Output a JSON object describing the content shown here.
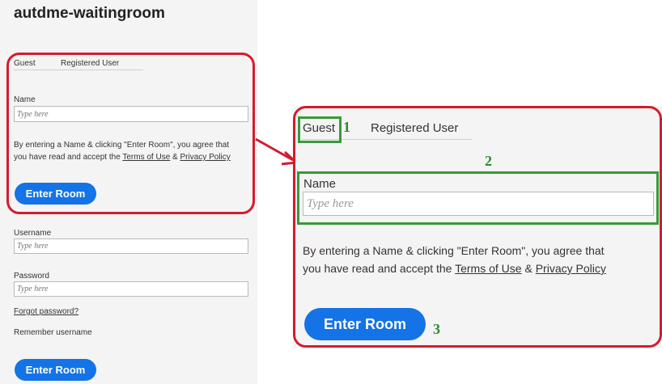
{
  "room": {
    "title": "autdme-waitingroom"
  },
  "tabs": {
    "guest": "Guest",
    "registered": "Registered User"
  },
  "guest_form": {
    "name_label": "Name",
    "name_placeholder": "Type here",
    "notice_line1": "By entering a Name & clicking \"Enter Room\", you agree that",
    "notice_line2_prefix": "you have read and accept the ",
    "terms_link": "Terms of Use",
    "amp": " & ",
    "privacy_link": "Privacy Policy",
    "enter_button": "Enter Room"
  },
  "login_form": {
    "username_label": "Username",
    "username_placeholder": "Type here",
    "password_label": "Password",
    "password_placeholder": "Type here",
    "forgot_link": "Forgot password?",
    "remember_label": "Remember username",
    "enter_button": "Enter Room"
  },
  "annotations": {
    "n1": "1",
    "n2": "2",
    "n3": "3"
  },
  "colors": {
    "accent_blue": "#1473e6",
    "callout_red": "#d31c2f",
    "highlight_green": "#3a9a38",
    "panel_bg": "#f4f4f4"
  }
}
